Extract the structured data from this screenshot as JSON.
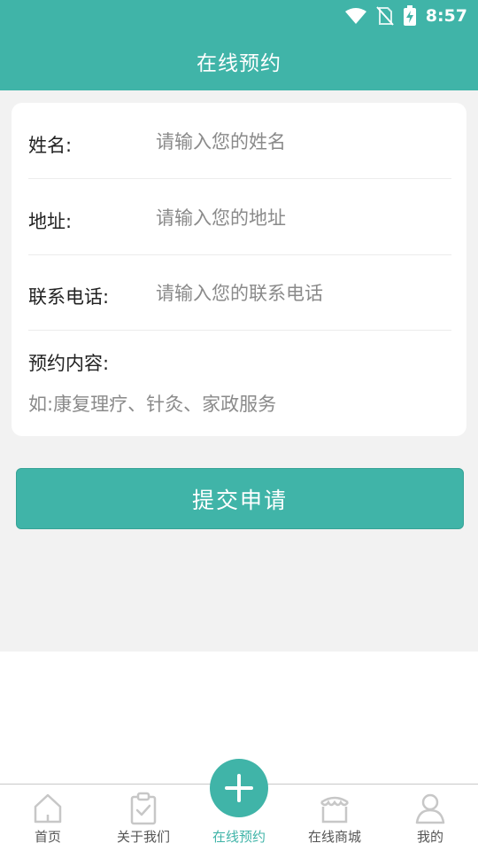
{
  "status_bar": {
    "time": "8:57",
    "icons": [
      "wifi-icon",
      "no-sim-icon",
      "battery-charging-icon"
    ]
  },
  "header": {
    "title": "在线预约"
  },
  "form": {
    "name": {
      "label": "姓名:",
      "placeholder": "请输入您的姓名",
      "value": ""
    },
    "address": {
      "label": "地址:",
      "placeholder": "请输入您的地址",
      "value": ""
    },
    "phone": {
      "label": "联系电话:",
      "placeholder": "请输入您的联系电话",
      "value": ""
    },
    "content": {
      "label": "预约内容:",
      "placeholder": "如:康复理疗、针灸、家政服务",
      "value": ""
    }
  },
  "submit_label": "提交申请",
  "tab_bar": {
    "items": [
      {
        "label": "首页",
        "icon": "home-icon",
        "active": false
      },
      {
        "label": "关于我们",
        "icon": "clipboard-check-icon",
        "active": false
      },
      {
        "label": "在线预约",
        "icon": "plus-icon",
        "active": true
      },
      {
        "label": "在线商城",
        "icon": "store-icon",
        "active": false
      },
      {
        "label": "我的",
        "icon": "user-icon",
        "active": false
      }
    ]
  },
  "colors": {
    "accent": "#40b4a8",
    "background": "#f2f2f2",
    "placeholder": "#8a8a8a",
    "tab_inactive": "#555555"
  }
}
